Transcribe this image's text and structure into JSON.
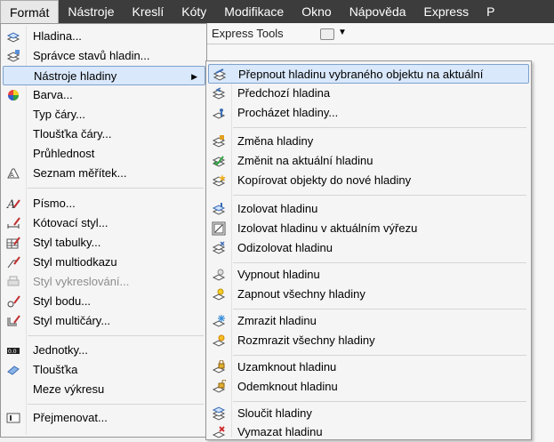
{
  "menubar": {
    "items": [
      "Formát",
      "Nástroje",
      "Kreslí",
      "Kóty",
      "Modifikace",
      "Okno",
      "Nápověda",
      "Express",
      "P"
    ]
  },
  "background": {
    "tab_label": "Express Tools"
  },
  "format_menu": {
    "items": [
      {
        "label": "Hladina...",
        "icon": "layer-icon"
      },
      {
        "label": "Správce stavů hladin...",
        "icon": "layer-states-icon"
      },
      {
        "label": "Nástroje hladiny",
        "icon": "none",
        "submenu": true
      },
      {
        "label": "Barva...",
        "icon": "color-wheel-icon"
      },
      {
        "label": "Typ čáry...",
        "icon": "none"
      },
      {
        "label": "Tloušťka čáry...",
        "icon": "none"
      },
      {
        "label": "Průhlednost",
        "icon": "none"
      },
      {
        "label": "Seznam měřítek...",
        "icon": "scale-list-icon"
      },
      {
        "label": "Písmo...",
        "icon": "text-style-icon"
      },
      {
        "label": "Kótovací styl...",
        "icon": "dimension-style-icon"
      },
      {
        "label": "Styl tabulky...",
        "icon": "table-style-icon"
      },
      {
        "label": "Styl multiodkazu",
        "icon": "multileader-style-icon"
      },
      {
        "label": "Styl vykreslování...",
        "icon": "plot-style-icon",
        "disabled": true
      },
      {
        "label": "Styl bodu...",
        "icon": "point-style-icon"
      },
      {
        "label": "Styl multičáry...",
        "icon": "multiline-style-icon"
      },
      {
        "label": "Jednotky...",
        "icon": "units-icon"
      },
      {
        "label": "Tloušťka",
        "icon": "thickness-icon"
      },
      {
        "label": "Meze výkresu",
        "icon": "none"
      },
      {
        "label": "Přejmenovat...",
        "icon": "rename-icon"
      }
    ]
  },
  "layer_tools_menu": {
    "items": [
      {
        "label": "Přepnout hladinu vybraného objektu na aktuální",
        "icon": "make-current-icon"
      },
      {
        "label": "Předchozí hladina",
        "icon": "previous-layer-icon"
      },
      {
        "label": "Procházet hladiny...",
        "icon": "layer-walk-icon"
      },
      {
        "label": "Změna hladiny",
        "icon": "match-layer-icon"
      },
      {
        "label": "Změnit na aktuální hladinu",
        "icon": "change-to-current-icon"
      },
      {
        "label": "Kopírovat objekty do nové hladiny",
        "icon": "copy-to-layer-icon"
      },
      {
        "label": "Izolovat hladinu",
        "icon": "isolate-layer-icon"
      },
      {
        "label": "Izolovat hladinu v aktuálním výřezu",
        "icon": "isolate-viewport-icon"
      },
      {
        "label": "Odizolovat hladinu",
        "icon": "unisolate-layer-icon"
      },
      {
        "label": "Vypnout hladinu",
        "icon": "layer-off-icon"
      },
      {
        "label": "Zapnout všechny hladiny",
        "icon": "layer-on-icon"
      },
      {
        "label": "Zmrazit hladinu",
        "icon": "freeze-layer-icon"
      },
      {
        "label": "Rozmrazit všechny hladiny",
        "icon": "thaw-layers-icon"
      },
      {
        "label": "Uzamknout hladinu",
        "icon": "lock-layer-icon"
      },
      {
        "label": "Odemknout hladinu",
        "icon": "unlock-layer-icon"
      },
      {
        "label": "Sloučit hladiny",
        "icon": "merge-layers-icon"
      },
      {
        "label": "Vymazat hladinu",
        "icon": "delete-layer-icon"
      }
    ]
  },
  "colors": {
    "menubar_bg": "#3c3c3c",
    "highlight_bg": "#d9e8fb",
    "highlight_border": "#7da2ce",
    "disabled_text": "#8d8d8d"
  }
}
